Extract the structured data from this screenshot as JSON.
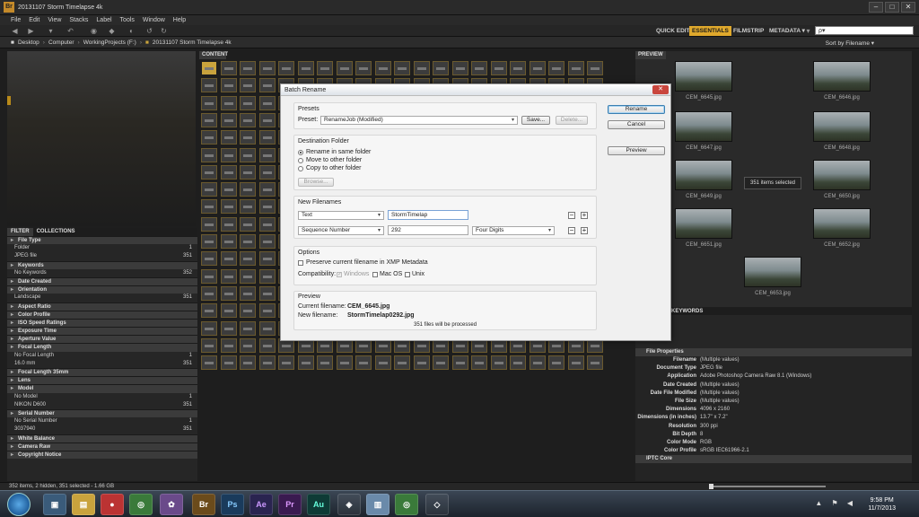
{
  "window": {
    "title": "20131107 Storm Timelapse 4k",
    "controls": [
      "–",
      "□",
      "✕"
    ]
  },
  "menu": [
    "File",
    "Edit",
    "View",
    "Stacks",
    "Label",
    "Tools",
    "Window",
    "Help"
  ],
  "toolbar": {
    "workspaces": [
      "QUICK EDIT",
      "ESSENTIALS",
      "FILMSTRIP",
      "METADATA ▾"
    ],
    "active_workspace": "ESSENTIALS",
    "search_placeholder": "ρ▾"
  },
  "path": [
    "Desktop",
    "Computer",
    "WorkingProjects (F:)",
    "20131107 Storm Timelapse 4k"
  ],
  "sort": "Sort by Filename ▾",
  "panels": {
    "content_tab": "CONTENT",
    "preview_tab": "PREVIEW",
    "keywords_tab": "KEYWORDS"
  },
  "filter": {
    "tabs": [
      "FILTER",
      "COLLECTIONS"
    ],
    "rows": [
      {
        "kind": "h",
        "label": "File Type"
      },
      {
        "kind": "i",
        "label": "Folder",
        "count": "1"
      },
      {
        "kind": "i",
        "label": "JPEG file",
        "count": "351"
      },
      {
        "kind": "h",
        "label": "Keywords"
      },
      {
        "kind": "i",
        "label": "No Keywords",
        "count": "352"
      },
      {
        "kind": "h",
        "label": "Date Created"
      },
      {
        "kind": "h",
        "label": "Orientation"
      },
      {
        "kind": "i",
        "label": "Landscape",
        "count": "351"
      },
      {
        "kind": "h",
        "label": "Aspect Ratio"
      },
      {
        "kind": "h",
        "label": "Color Profile"
      },
      {
        "kind": "h",
        "label": "ISO Speed Ratings"
      },
      {
        "kind": "h",
        "label": "Exposure Time"
      },
      {
        "kind": "h",
        "label": "Aperture Value"
      },
      {
        "kind": "h",
        "label": "Focal Length"
      },
      {
        "kind": "i",
        "label": "No Focal Length",
        "count": "1"
      },
      {
        "kind": "i",
        "label": "16.0 mm",
        "count": "351"
      },
      {
        "kind": "h",
        "label": "Focal Length 35mm"
      },
      {
        "kind": "h",
        "label": "Lens"
      },
      {
        "kind": "h",
        "label": "Model"
      },
      {
        "kind": "i",
        "label": "No Model",
        "count": "1"
      },
      {
        "kind": "i",
        "label": "NIKON D600",
        "count": "351"
      },
      {
        "kind": "h",
        "label": "Serial Number"
      },
      {
        "kind": "i",
        "label": "No Serial Number",
        "count": "1"
      },
      {
        "kind": "i",
        "label": "3037940",
        "count": "351"
      },
      {
        "kind": "h",
        "label": "White Balance"
      },
      {
        "kind": "h",
        "label": "Camera Raw"
      },
      {
        "kind": "h",
        "label": "Copyright Notice"
      }
    ]
  },
  "right_thumbs": [
    {
      "caption": "CEM_6645.jpg"
    },
    {
      "caption": "CEM_6646.jpg"
    },
    {
      "caption": "CEM_6647.jpg"
    },
    {
      "caption": "CEM_6648.jpg"
    },
    {
      "caption": "CEM_6649.jpg"
    },
    {
      "caption": "CEM_6650.jpg"
    },
    {
      "caption": "CEM_6651.jpg"
    },
    {
      "caption": "CEM_6652.jpg"
    },
    {
      "caption": "CEM_6653.jpg"
    }
  ],
  "selection_badge": "351 items selected",
  "file_properties": {
    "header": "File Properties",
    "rows": [
      {
        "k": "Filename",
        "v": "(Multiple values)"
      },
      {
        "k": "Document Type",
        "v": "JPEG file"
      },
      {
        "k": "Application",
        "v": "Adobe Photoshop Camera Raw 8.1 (Windows)"
      },
      {
        "k": "Date Created",
        "v": "(Multiple values)"
      },
      {
        "k": "Date File Modified",
        "v": "(Multiple values)"
      },
      {
        "k": "File Size",
        "v": "(Multiple values)"
      },
      {
        "k": "Dimensions",
        "v": "4096 x 2160"
      },
      {
        "k": "Dimensions (in inches)",
        "v": "13.7\" x 7.2\""
      },
      {
        "k": "Resolution",
        "v": "300 ppi"
      },
      {
        "k": "Bit Depth",
        "v": "8"
      },
      {
        "k": "Color Mode",
        "v": "RGB"
      },
      {
        "k": "Color Profile",
        "v": "sRGB IEC61966-2.1"
      }
    ],
    "iptc": "IPTC Core"
  },
  "status": "352 items, 2 hidden, 351 selected - 1.66 GB",
  "dialog": {
    "title": "Batch Rename",
    "presets_title": "Presets",
    "preset_label": "Preset:",
    "preset_value": "RenameJob (Modified)",
    "save": "Save...",
    "delete": "Delete...",
    "rename": "Rename",
    "cancel": "Cancel",
    "preview_btn": "Preview",
    "dest_title": "Destination Folder",
    "dest_options": [
      "Rename in same folder",
      "Move to other folder",
      "Copy to other folder"
    ],
    "browse": "Browse...",
    "newname_title": "New Filenames",
    "row1_type": "Text",
    "row1_value": "StormTimelap",
    "row2_type": "Sequence Number",
    "row2_value": "292",
    "row2_digits": "Four Digits",
    "options_title": "Options",
    "preserve": "Preserve current filename in XMP Metadata",
    "compat_label": "Compatibility:",
    "compat": [
      "Windows",
      "Mac OS",
      "Unix"
    ],
    "preview_title": "Preview",
    "current_label": "Current filename:",
    "current_value": "CEM_6645.jpg",
    "new_label": "New filename:",
    "new_value": "StormTimelap0292.jpg",
    "processed": "351 files will be processed"
  },
  "taskbar": {
    "apps": [
      "Br",
      "Ps",
      "Ae",
      "Pr",
      "Au"
    ],
    "time": "9:58 PM",
    "date": "11/7/2013"
  },
  "colors": {
    "accent": "#e0a92c",
    "panel": "#2b2b2b",
    "thumb_border": "#6b5a2e"
  }
}
